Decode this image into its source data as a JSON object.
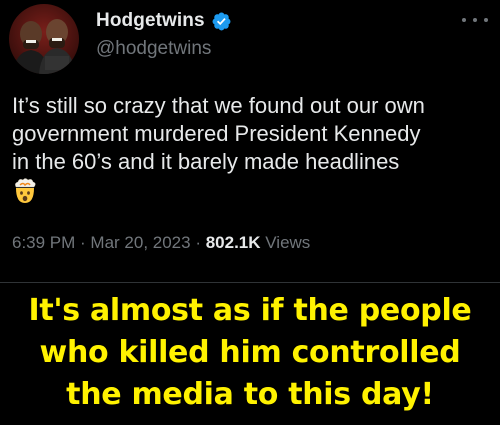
{
  "author": {
    "display_name": "Hodgetwins",
    "handle": "@hodgetwins",
    "verified": true,
    "avatar_icon": "two-men-avatar"
  },
  "tweet": {
    "lines": [
      "It’s still so crazy that we found out our own",
      "government murdered President Kennedy",
      "in the 60’s and it barely made headlines"
    ],
    "emoji": "exploding-head-emoji"
  },
  "meta": {
    "time": "6:39 PM",
    "separator": " · ",
    "date": "Mar 20, 2023",
    "views_count": "802.1K",
    "views_label": " Views"
  },
  "caption": {
    "lines": [
      "It's almost as if the people",
      "who killed him controlled",
      "the media to this day!"
    ]
  },
  "colors": {
    "background": "#000000",
    "text": "#e7e9ea",
    "secondary": "#71767b",
    "verified": "#1d9bf0",
    "caption": "#fff200"
  }
}
